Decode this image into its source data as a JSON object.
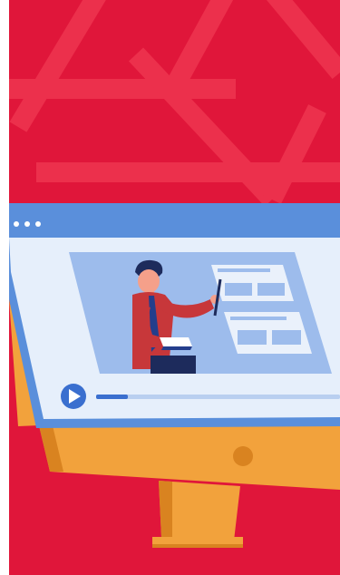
{
  "illustration": {
    "subject": "online-video-lesson",
    "icons": [
      "play-icon",
      "window-dots-icon",
      "pointer-stick-icon",
      "book-icon",
      "slide-card-icon"
    ],
    "colors": {
      "brand_red": "#e0163a",
      "brand_red_dark": "#c8102e",
      "pattern_red": "#ef3550",
      "screen_frame": "#5a8fdb",
      "screen_bg": "#e6effb",
      "video_bg": "#9dbcec",
      "monitor_orange": "#f2a23c",
      "monitor_orange_dark": "#d98320",
      "teacher_shirt": "#c7373a",
      "teacher_tie": "#243e8c",
      "teacher_hair": "#1d2b5c"
    },
    "video_progress": 0.13
  }
}
